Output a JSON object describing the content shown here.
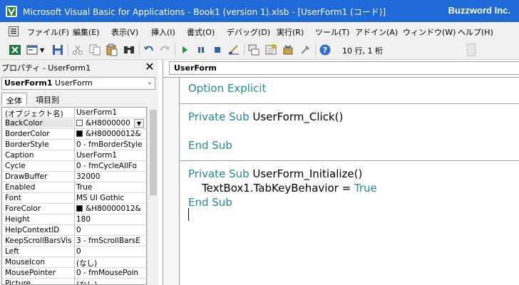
{
  "window": {
    "title": "Microsoft Visual Basic for Applications - Book1 (version 1).xlsb - [UserForm1 (コード)]",
    "brand": "Buzzword Inc."
  },
  "menu": {
    "items": [
      "ファイル(F)",
      "編集(E)",
      "表示(V)",
      "挿入(I)",
      "書式(O)",
      "デバッグ(D)",
      "実行(R)",
      "ツール(T)",
      "アドイン(A)",
      "ウィンドウ(W)",
      "ヘルプ(H)"
    ]
  },
  "toolbar": {
    "position": "10 行, 1 桁",
    "icons": [
      "excel-icon",
      "insert-userform-icon",
      "save-icon",
      "cut-icon",
      "copy-icon",
      "paste-icon",
      "find-icon",
      "undo-icon",
      "redo-icon",
      "run-icon",
      "break-icon",
      "reset-icon",
      "design-mode-icon",
      "project-explorer-icon",
      "properties-icon",
      "object-browser-icon",
      "toolbox-icon",
      "help-icon"
    ]
  },
  "properties": {
    "title": "プロパティ - UserForm1",
    "object_name": "UserForm1",
    "object_type": "UserForm",
    "tabs": [
      "全体",
      "項目別"
    ],
    "rows": [
      {
        "name": "(オブジェクト名)",
        "value": "UserForm1"
      },
      {
        "name": "BackColor",
        "value": "&H8000000",
        "swatch": "#ffffff",
        "dropdown": true
      },
      {
        "name": "BorderColor",
        "value": "&H80000012&",
        "swatch": "#000000"
      },
      {
        "name": "BorderStyle",
        "value": "0 - fmBorderStyle"
      },
      {
        "name": "Caption",
        "value": "UserForm1"
      },
      {
        "name": "Cycle",
        "value": "0 - fmCycleAllFo"
      },
      {
        "name": "DrawBuffer",
        "value": "32000"
      },
      {
        "name": "Enabled",
        "value": "True"
      },
      {
        "name": "Font",
        "value": "MS UI Gothic"
      },
      {
        "name": "ForeColor",
        "value": "&H80000012&",
        "swatch": "#000000"
      },
      {
        "name": "Height",
        "value": "180"
      },
      {
        "name": "HelpContextID",
        "value": "0"
      },
      {
        "name": "KeepScrollBarsVis",
        "value": "3 - fmScrollBarsE"
      },
      {
        "name": "Left",
        "value": "0"
      },
      {
        "name": "MouseIcon",
        "value": "(なし)"
      },
      {
        "name": "MousePointer",
        "value": "0 - fmMousePoin"
      },
      {
        "name": "Picture",
        "value": "(なし)"
      }
    ]
  },
  "code": {
    "object_combo": "UserForm",
    "lines": [
      {
        "kw": "Option Explicit",
        "rest": ""
      },
      {
        "kw": "Private Sub ",
        "rest": "UserForm_Click()"
      },
      {
        "kw": "End Sub",
        "rest": ""
      },
      {
        "kw": "Private Sub ",
        "rest": "UserForm_Initialize()"
      },
      {
        "pre": "    TextBox1.TabKeyBehavior = ",
        "kw": "True",
        "rest": ""
      },
      {
        "kw": "End Sub",
        "rest": ""
      }
    ]
  },
  "colors": {
    "titlebar": "#1f6ad6",
    "keyword": "#1f8a9c"
  }
}
